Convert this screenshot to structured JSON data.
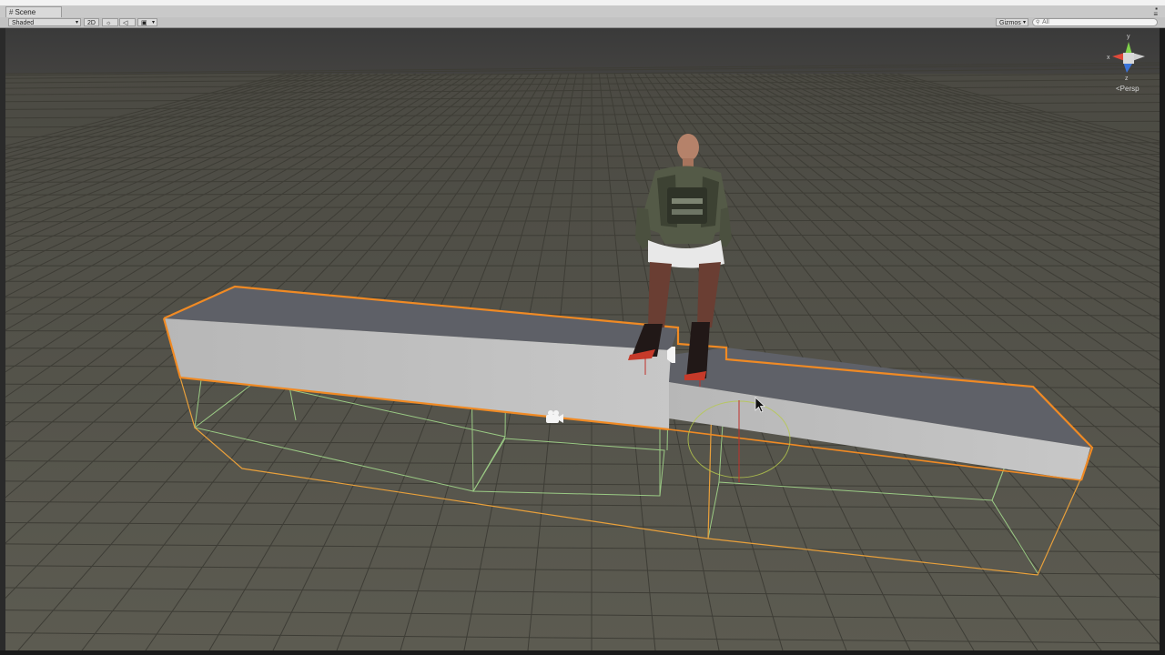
{
  "window": {
    "tab_label": "Scene",
    "minimize_label": "▪",
    "close_label": "≡"
  },
  "toolbar": {
    "shading_mode": "Shaded",
    "mode_2d": "2D",
    "lighting_icon": "sun-icon",
    "audio_icon": "speaker-icon",
    "effects_icon": "image-icon",
    "gizmos_label": "Gizmos",
    "search_placeholder": "All"
  },
  "gizmo": {
    "y_axis": "y",
    "x_axis": "x",
    "z_axis": "z",
    "projection": "Persp"
  },
  "colors": {
    "sky": "#3b3b3b",
    "ground": "#55544a",
    "grid_line": "#3f3e36",
    "selection_outline": "#f08a24",
    "collider_wire": "#9cd88a",
    "platform_top": "#5f6168",
    "platform_side": "#bebebe"
  }
}
